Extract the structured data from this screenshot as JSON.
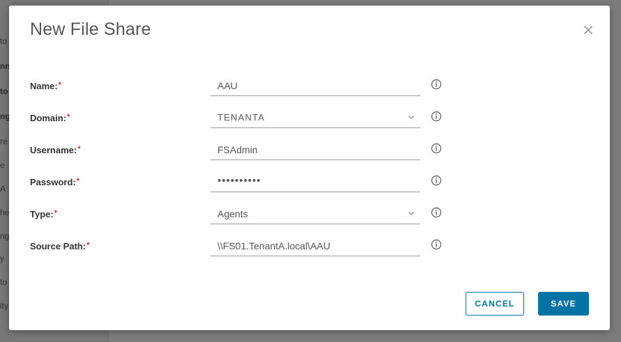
{
  "background": {
    "fragments": [
      "to",
      "nn",
      "to",
      "ng",
      "re",
      "e",
      "A",
      "he",
      "ng",
      "y",
      "to",
      "ity"
    ]
  },
  "dialog": {
    "title": "New File Share",
    "required_mark": "*",
    "fields": [
      {
        "label": "Name:",
        "value": "AAU",
        "type": "text"
      },
      {
        "label": "Domain:",
        "value": "TENANTA",
        "type": "select"
      },
      {
        "label": "Username:",
        "value": "FSAdmin",
        "type": "text"
      },
      {
        "label": "Password:",
        "value": "••••••••••",
        "type": "password"
      },
      {
        "label": "Type:",
        "value": "Agents",
        "type": "select"
      },
      {
        "label": "Source Path:",
        "value": "\\\\FS01.TenantA.local\\AAU",
        "type": "text"
      }
    ],
    "cancel_label": "CANCEL",
    "save_label": "SAVE"
  },
  "colors": {
    "primary": "#0072a3",
    "required": "#e0281d",
    "title": "#565656"
  },
  "icons": {
    "close": "close-icon",
    "info": "info-icon",
    "dropdown": "chevron-down-icon"
  }
}
